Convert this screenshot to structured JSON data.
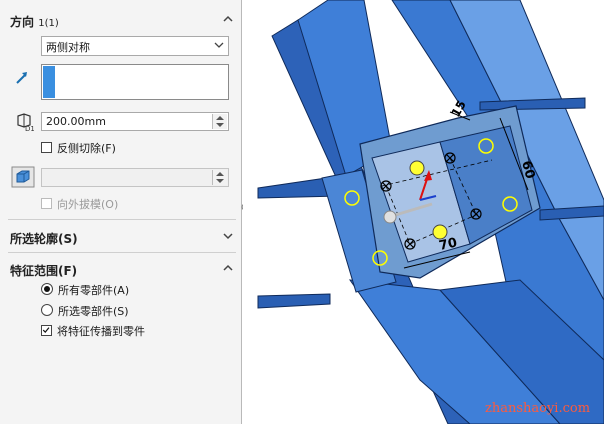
{
  "direction": {
    "title": "方向",
    "subtitle": "1(1)",
    "end_condition": "两侧对称",
    "depth_value": "200.00mm",
    "flip_side_label": "反侧切除(F)",
    "draft_outward_label": "向外拔模(O)"
  },
  "selected_contours": {
    "title": "所选轮廓(S)"
  },
  "feature_scope": {
    "title": "特征范围(F)",
    "options": [
      "所有零部件(A)",
      "所选零部件(S)"
    ],
    "selected_option": "所有零部件(A)",
    "propagate_label": "将特征传播到零件"
  },
  "viewport": {
    "dim_60": "60",
    "dim_70": "70",
    "dim_15": "15",
    "watermark": "zhanshaoyi.com"
  },
  "colors": {
    "steel": "#3f7fd8",
    "steel_dark": "#2a5fb3",
    "plate": "#5f8fc0",
    "hole_fill": "#ffff33",
    "watermark": "#ff5a3c",
    "arrow_red": "#dd1111"
  },
  "icons": [
    "chevron-up-icon",
    "chevron-down-icon",
    "direction-arrow-icon",
    "depth-icon",
    "draft-icon",
    "panel-collapse-handle-icon"
  ]
}
